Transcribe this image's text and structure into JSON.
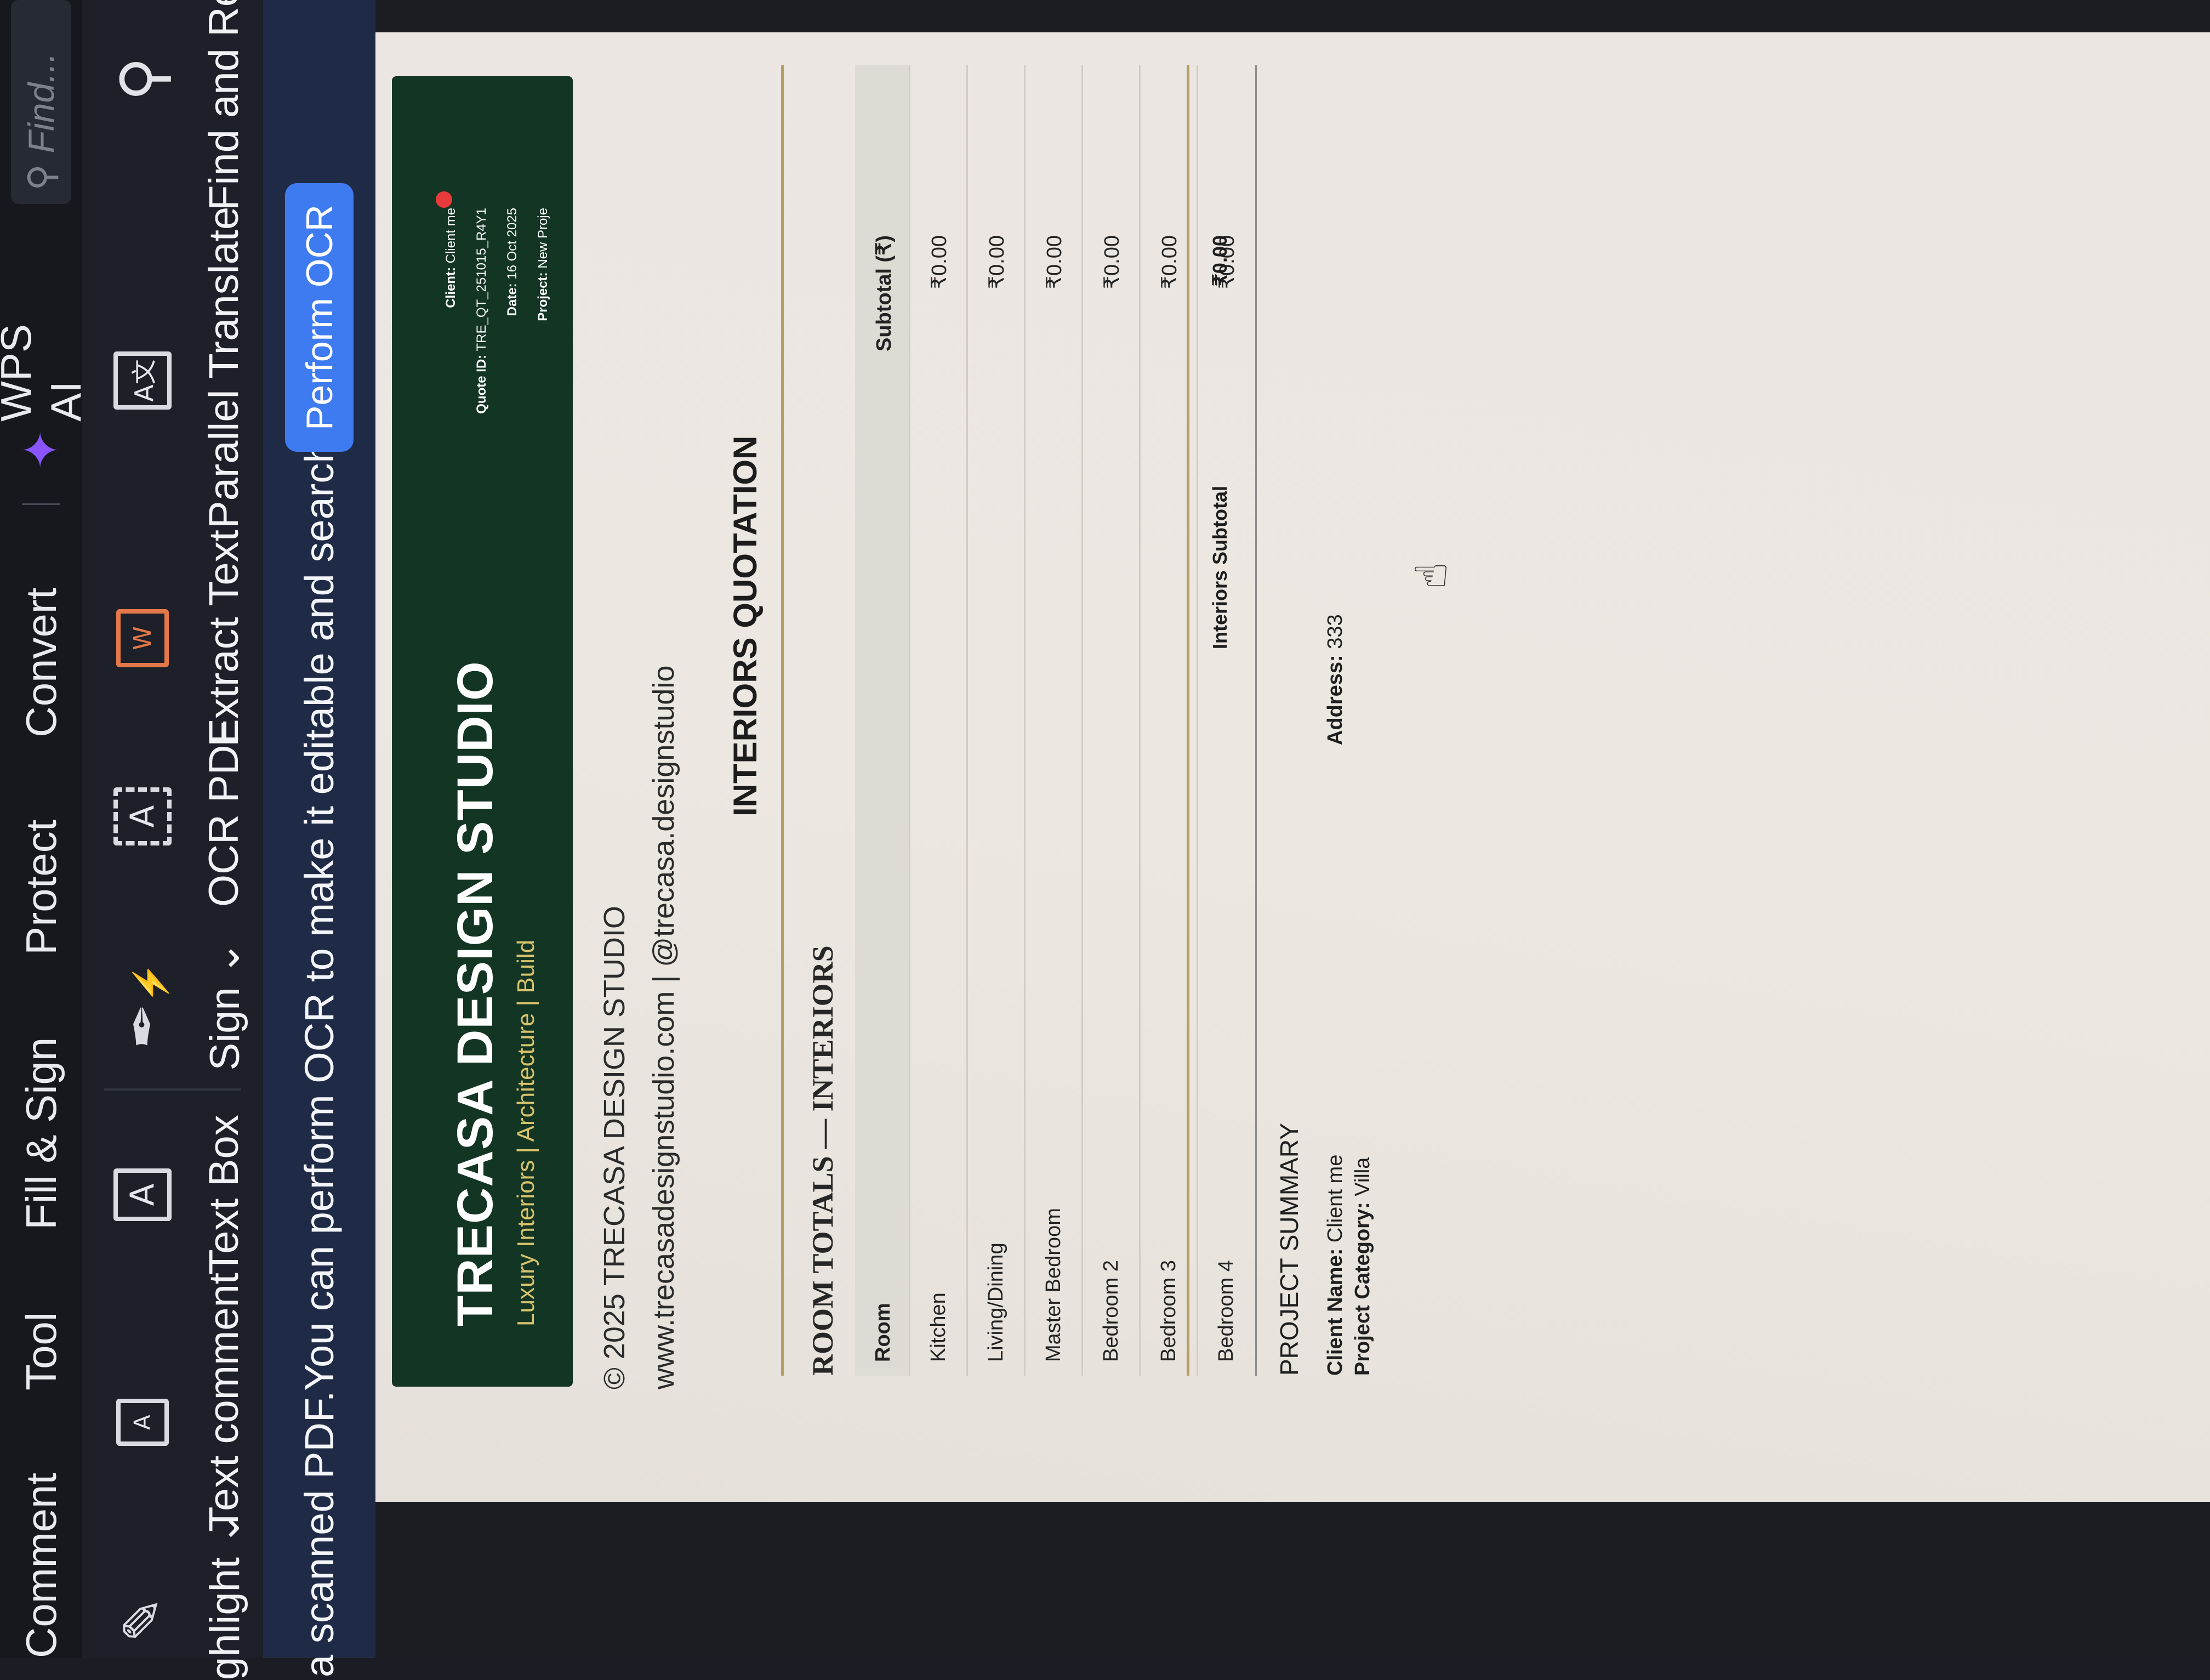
{
  "menubar": {
    "items": [
      "Comment",
      "Tool",
      "Fill & Sign",
      "Protect",
      "Convert"
    ],
    "wps_ai": "WPS AI",
    "find_placeholder": "Find..."
  },
  "toolbar": {
    "highlight": "ghlight",
    "text_comment": "Text comment",
    "text_box": "Text Box",
    "sign": "Sign",
    "ocr_pdf": "OCR PDF",
    "extract_text": "Extract Text",
    "parallel_translate": "Parallel Translate",
    "find_replace": "Find and Rep"
  },
  "ocr_banner": {
    "message": "a scanned PDF.You can perform OCR to make it editable and searchable.",
    "button": "Perform OCR"
  },
  "document": {
    "studio_name": "TRECASA DESIGN STUDIO",
    "tagline": "Luxury Interiors | Architecture | Build",
    "meta": {
      "client_label": "Client:",
      "client_value": "Client me",
      "quote_label": "Quote ID:",
      "quote_value": "TRE_QT_251015_R4Y1",
      "date_label": "Date:",
      "date_value": "16 Oct 2025",
      "project_label": "Project:",
      "project_value": "New Proje"
    },
    "copyright": "© 2025 TRECASA DESIGN STUDIO",
    "website": "www.trecasadesignstudio.com | @trecasa.designstudio",
    "quote_title": "INTERIORS QUOTATION",
    "section_title": "ROOM TOTALS — INTERIORS",
    "table": {
      "headers": [
        "Room",
        "Subtotal (₹)"
      ],
      "rows": [
        [
          "Kitchen",
          "₹0.00"
        ],
        [
          "Living/Dining",
          "₹0.00"
        ],
        [
          "Master Bedroom",
          "₹0.00"
        ],
        [
          "Bedroom 2",
          "₹0.00"
        ],
        [
          "Bedroom 3",
          "₹0.00"
        ],
        [
          "Bedroom 4",
          "₹0.00"
        ]
      ]
    },
    "subtotal_label": "Interiors Subtotal",
    "subtotal_value": "₹0.00",
    "summary": {
      "title": "PROJECT SUMMARY",
      "client_name_label": "Client Name:",
      "client_name_value": "Client me",
      "address_label": "Address:",
      "address_value": "333",
      "category_label": "Project Category:",
      "category_value": "Villa"
    }
  },
  "colors": {
    "banner_green": "#133524",
    "accent_gold": "#b59f64",
    "ocr_button": "#3f7bf0"
  }
}
